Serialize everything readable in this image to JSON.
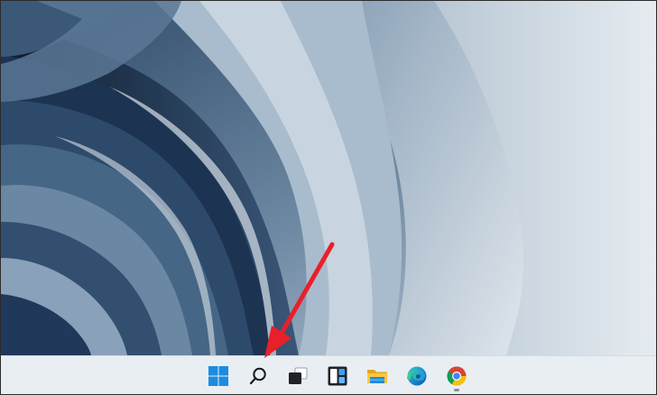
{
  "screen": {
    "type": "Windows 11 desktop",
    "accent_color": "#1a73e8"
  },
  "taskbar": {
    "icons": [
      {
        "name": "start-icon",
        "icon": "windows-logo"
      },
      {
        "name": "search-icon",
        "icon": "magnifier"
      },
      {
        "name": "task-view-icon",
        "icon": "task-view"
      },
      {
        "name": "widgets-icon",
        "icon": "widgets"
      },
      {
        "name": "file-explorer-icon",
        "icon": "folder"
      },
      {
        "name": "edge-icon",
        "icon": "edge"
      },
      {
        "name": "chrome-icon",
        "icon": "chrome"
      }
    ],
    "running_app": "chrome-icon"
  },
  "annotation": {
    "arrow_color": "#e8202a",
    "points_to": "search-icon"
  }
}
